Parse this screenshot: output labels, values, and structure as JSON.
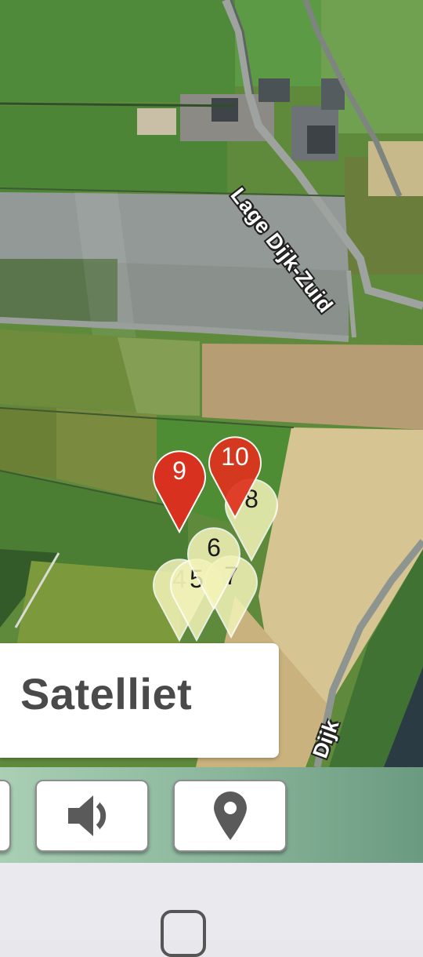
{
  "map": {
    "road_labels": [
      "Lage Dijk-Zuid",
      "Dijk"
    ],
    "markers": [
      {
        "label": "4",
        "style": "faded"
      },
      {
        "label": "5",
        "style": "yellow"
      },
      {
        "label": "7",
        "style": "yellow"
      },
      {
        "label": "6",
        "style": "yellow"
      },
      {
        "label": "8",
        "style": "yellow"
      },
      {
        "label": "9",
        "style": "red"
      },
      {
        "label": "10",
        "style": "red"
      }
    ],
    "colors": {
      "marker_red": "#d9311f",
      "marker_yellow": "#f3f3b8"
    }
  },
  "map_type": {
    "label": "Satelliet"
  },
  "toolbar": {
    "buttons": [
      {
        "name": "partial-button",
        "icon": "unknown"
      },
      {
        "name": "sound-button",
        "icon": "speaker-icon"
      },
      {
        "name": "location-button",
        "icon": "map-pin-icon"
      }
    ]
  }
}
